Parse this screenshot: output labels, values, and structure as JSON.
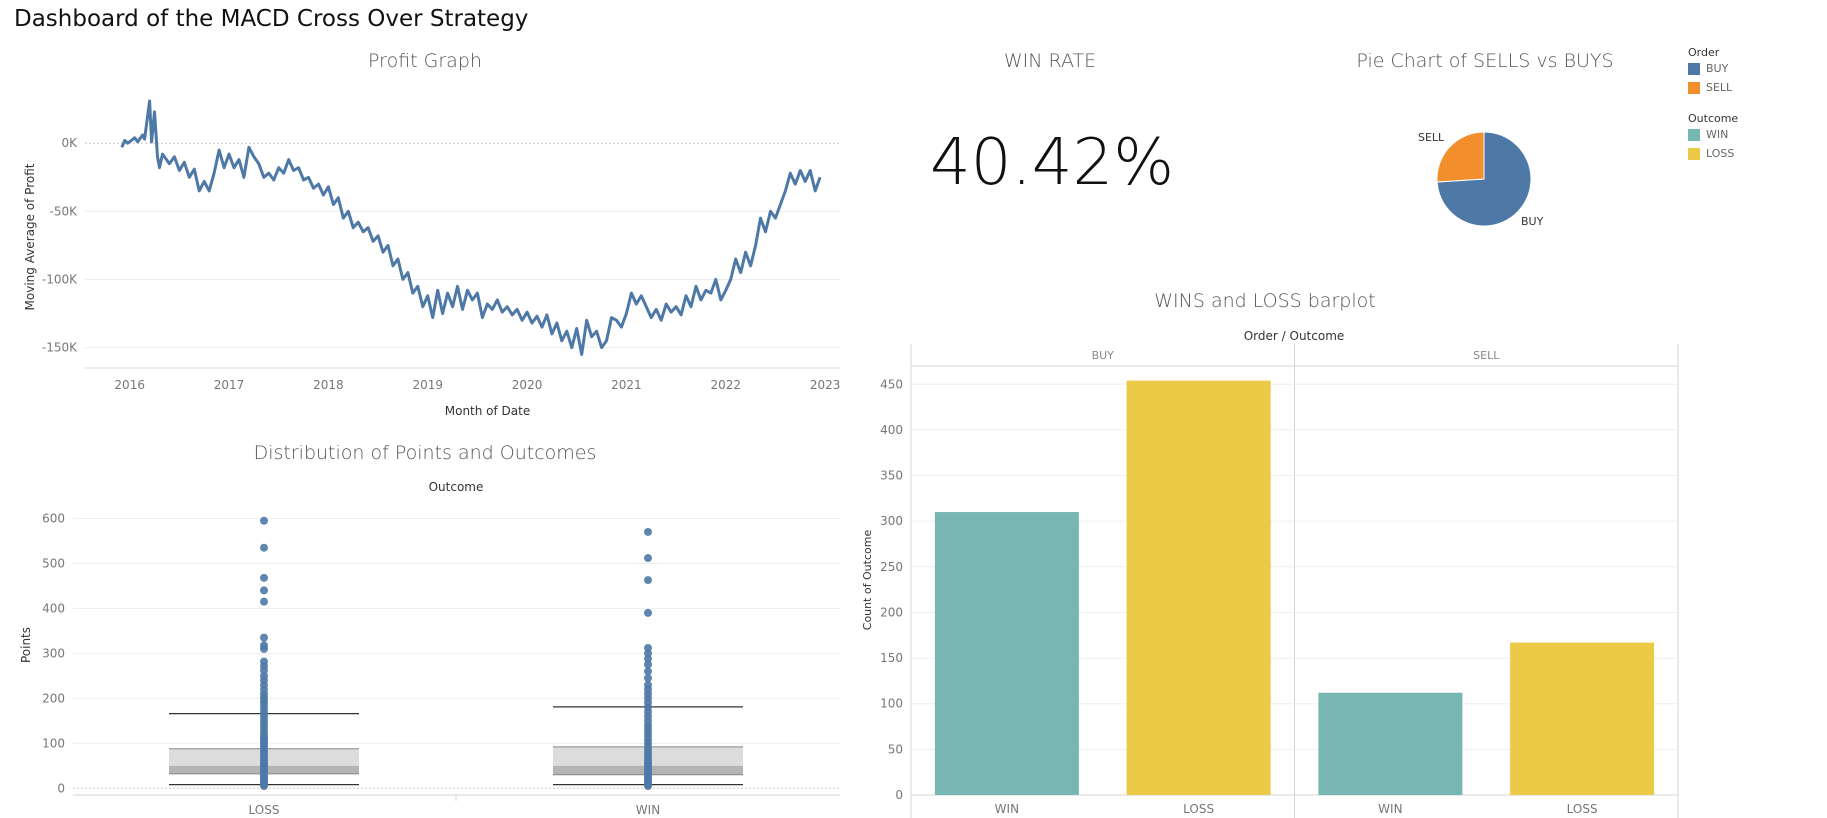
{
  "dashboard": {
    "title": "Dashboard of the MACD Cross Over Strategy"
  },
  "profit_graph": {
    "title": "Profit Graph"
  },
  "win_rate": {
    "title": "WIN RATE",
    "value": "40.42%"
  },
  "pie": {
    "title": "Pie Chart of SELLS vs BUYS"
  },
  "barplot": {
    "title": "WINS and LOSS barplot"
  },
  "boxplot": {
    "title": "Distribution of Points and Outcomes"
  },
  "legend": {
    "order_title": "Order",
    "order_items": [
      {
        "label": "BUY",
        "color": "#4e79a7"
      },
      {
        "label": "SELL",
        "color": "#f28e2b"
      }
    ],
    "outcome_title": "Outcome",
    "outcome_items": [
      {
        "label": "WIN",
        "color": "#76b7b2"
      },
      {
        "label": "LOSS",
        "color": "#edc948"
      }
    ]
  },
  "chart_data": [
    {
      "type": "line",
      "title": "Profit Graph",
      "xlabel": "Month of Date",
      "ylabel": "Moving Average of Profit",
      "x_ticks": [
        "2016",
        "2017",
        "2018",
        "2019",
        "2020",
        "2021",
        "2022",
        "2023"
      ],
      "y_ticks": [
        "0K",
        "-50K",
        "-100K",
        "-150K"
      ],
      "ylim": [
        -165000,
        42000
      ],
      "xlim": [
        2015.55,
        2023.15
      ],
      "grid": true,
      "color": "#4e79a7",
      "x": [
        2015.92,
        2015.95,
        2015.98,
        2016.05,
        2016.08,
        2016.13,
        2016.15,
        2016.2,
        2016.22,
        2016.25,
        2016.28,
        2016.3,
        2016.33,
        2016.37,
        2016.4,
        2016.45,
        2016.5,
        2016.55,
        2016.6,
        2016.65,
        2016.7,
        2016.75,
        2016.8,
        2016.85,
        2016.9,
        2016.95,
        2017.0,
        2017.05,
        2017.1,
        2017.15,
        2017.2,
        2017.25,
        2017.3,
        2017.35,
        2017.4,
        2017.45,
        2017.5,
        2017.55,
        2017.6,
        2017.65,
        2017.7,
        2017.75,
        2017.8,
        2017.85,
        2017.9,
        2017.95,
        2018.0,
        2018.05,
        2018.1,
        2018.15,
        2018.2,
        2018.25,
        2018.3,
        2018.35,
        2018.4,
        2018.45,
        2018.5,
        2018.55,
        2018.6,
        2018.65,
        2018.7,
        2018.75,
        2018.8,
        2018.85,
        2018.9,
        2018.95,
        2019.0,
        2019.05,
        2019.1,
        2019.15,
        2019.2,
        2019.25,
        2019.3,
        2019.35,
        2019.4,
        2019.45,
        2019.5,
        2019.55,
        2019.6,
        2019.65,
        2019.7,
        2019.75,
        2019.8,
        2019.85,
        2019.9,
        2019.95,
        2020.0,
        2020.05,
        2020.1,
        2020.15,
        2020.2,
        2020.25,
        2020.3,
        2020.35,
        2020.4,
        2020.45,
        2020.5,
        2020.55,
        2020.6,
        2020.65,
        2020.7,
        2020.75,
        2020.8,
        2020.85,
        2020.9,
        2020.95,
        2021.0,
        2021.05,
        2021.1,
        2021.15,
        2021.2,
        2021.25,
        2021.3,
        2021.35,
        2021.4,
        2021.45,
        2021.5,
        2021.55,
        2021.6,
        2021.65,
        2021.7,
        2021.75,
        2021.8,
        2021.85,
        2021.9,
        2021.95,
        2022.0,
        2022.05,
        2022.1,
        2022.15,
        2022.2,
        2022.25,
        2022.3,
        2022.35,
        2022.4,
        2022.45,
        2022.5,
        2022.55,
        2022.6,
        2022.65,
        2022.7,
        2022.75,
        2022.8,
        2022.85,
        2022.9,
        2022.95
      ],
      "y": [
        -3000,
        2000,
        0,
        4000,
        1000,
        6000,
        3000,
        31000,
        1000,
        23000,
        -10000,
        -18000,
        -8000,
        -12000,
        -15000,
        -10000,
        -20000,
        -14000,
        -25000,
        -19000,
        -35000,
        -28000,
        -35000,
        -22000,
        -5000,
        -18000,
        -8000,
        -18000,
        -12000,
        -25000,
        -3000,
        -10000,
        -15000,
        -25000,
        -22000,
        -27000,
        -18000,
        -22000,
        -12000,
        -20000,
        -18000,
        -27000,
        -25000,
        -33000,
        -30000,
        -38000,
        -32000,
        -45000,
        -40000,
        -55000,
        -50000,
        -62000,
        -58000,
        -65000,
        -62000,
        -72000,
        -68000,
        -80000,
        -75000,
        -90000,
        -85000,
        -100000,
        -95000,
        -110000,
        -105000,
        -120000,
        -112000,
        -128000,
        -108000,
        -125000,
        -110000,
        -120000,
        -105000,
        -122000,
        -108000,
        -115000,
        -110000,
        -128000,
        -118000,
        -122000,
        -115000,
        -124000,
        -120000,
        -126000,
        -122000,
        -130000,
        -124000,
        -132000,
        -127000,
        -135000,
        -126000,
        -140000,
        -132000,
        -145000,
        -138000,
        -150000,
        -136000,
        -155000,
        -130000,
        -142000,
        -138000,
        -150000,
        -145000,
        -128000,
        -130000,
        -135000,
        -125000,
        -110000,
        -118000,
        -112000,
        -120000,
        -128000,
        -122000,
        -130000,
        -118000,
        -124000,
        -120000,
        -126000,
        -112000,
        -120000,
        -105000,
        -115000,
        -108000,
        -110000,
        -100000,
        -115000,
        -108000,
        -100000,
        -85000,
        -95000,
        -80000,
        -90000,
        -75000,
        -55000,
        -65000,
        -50000,
        -55000,
        -45000,
        -35000,
        -22000,
        -30000,
        -20000,
        -28000,
        -20000,
        -35000,
        -25000,
        -32000,
        -20000
      ]
    },
    {
      "type": "pie",
      "title": "Pie Chart of SELLS vs BUYS",
      "labels": [
        "BUY",
        "SELL"
      ],
      "values": [
        74,
        26
      ],
      "colors": [
        "#4e79a7",
        "#f28e2b"
      ]
    },
    {
      "type": "bar",
      "title": "WINS and LOSS barplot",
      "header": "Order / Outcome",
      "ylabel": "Count of Outcome",
      "ylim": [
        0,
        470
      ],
      "y_ticks": [
        0,
        50,
        100,
        150,
        200,
        250,
        300,
        350,
        400,
        450
      ],
      "panels": [
        {
          "name": "BUY",
          "categories": [
            "WIN",
            "LOSS"
          ],
          "values": [
            310,
            454
          ]
        },
        {
          "name": "SELL",
          "categories": [
            "WIN",
            "LOSS"
          ],
          "values": [
            112,
            167
          ]
        }
      ],
      "colors": {
        "WIN": "#76b7b2",
        "LOSS": "#edc948"
      }
    },
    {
      "type": "box",
      "title": "Distribution of Points and Outcomes",
      "header": "Outcome",
      "ylabel": "Points",
      "ylim": [
        -15,
        630
      ],
      "y_ticks": [
        0,
        100,
        200,
        300,
        400,
        500,
        600
      ],
      "groups": [
        {
          "name": "LOSS",
          "whisker_low": 8,
          "q1": 32,
          "median": 50,
          "q3": 88,
          "whisker_high": 166,
          "points": [
            5,
            8,
            12,
            15,
            18,
            22,
            25,
            28,
            30,
            33,
            36,
            40,
            44,
            48,
            52,
            55,
            60,
            65,
            70,
            75,
            80,
            85,
            90,
            95,
            100,
            105,
            110,
            115,
            120,
            128,
            135,
            142,
            150,
            158,
            165,
            172,
            180,
            188,
            195,
            202,
            210,
            220,
            230,
            240,
            250,
            262,
            272,
            282,
            310,
            318,
            335,
            415,
            440,
            468,
            535,
            595
          ]
        },
        {
          "name": "WIN",
          "whisker_low": 8,
          "q1": 30,
          "median": 50,
          "q3": 92,
          "whisker_high": 181,
          "points": [
            5,
            8,
            12,
            15,
            20,
            25,
            30,
            35,
            40,
            45,
            50,
            55,
            60,
            66,
            72,
            78,
            85,
            92,
            100,
            108,
            116,
            124,
            132,
            140,
            150,
            160,
            170,
            180,
            190,
            200,
            210,
            220,
            230,
            245,
            260,
            275,
            288,
            300,
            312,
            390,
            463,
            512,
            570
          ]
        }
      ]
    }
  ]
}
